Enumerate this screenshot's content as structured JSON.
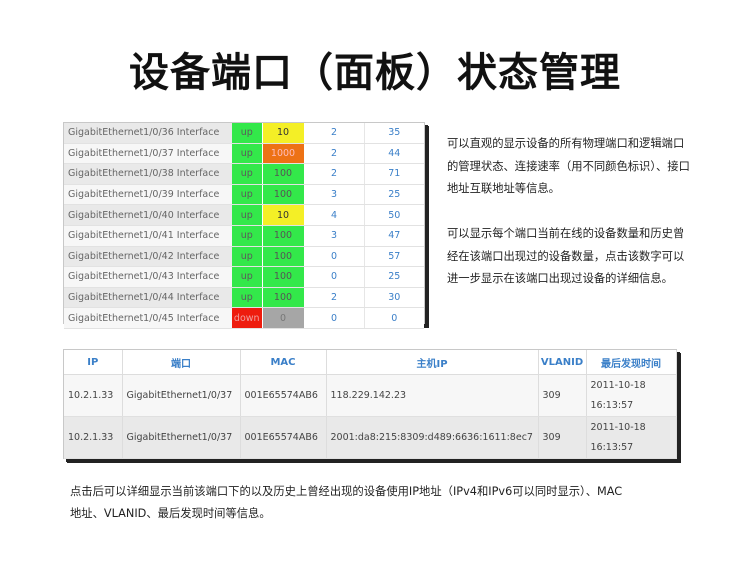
{
  "title": "设备端口（面板）状态管理",
  "ports": [
    {
      "iface": "GigabitEthernet1/0/36 Interface",
      "status": "up",
      "speed": "10",
      "speed_color": "yellow",
      "current": "2",
      "history": "35"
    },
    {
      "iface": "GigabitEthernet1/0/37 Interface",
      "status": "up",
      "speed": "1000",
      "speed_color": "orange",
      "current": "2",
      "history": "44"
    },
    {
      "iface": "GigabitEthernet1/0/38 Interface",
      "status": "up",
      "speed": "100",
      "speed_color": "green",
      "current": "2",
      "history": "71"
    },
    {
      "iface": "GigabitEthernet1/0/39 Interface",
      "status": "up",
      "speed": "100",
      "speed_color": "green",
      "current": "3",
      "history": "25"
    },
    {
      "iface": "GigabitEthernet1/0/40 Interface",
      "status": "up",
      "speed": "10",
      "speed_color": "yellow",
      "current": "4",
      "history": "50"
    },
    {
      "iface": "GigabitEthernet1/0/41 Interface",
      "status": "up",
      "speed": "100",
      "speed_color": "green",
      "current": "3",
      "history": "47"
    },
    {
      "iface": "GigabitEthernet1/0/42 Interface",
      "status": "up",
      "speed": "100",
      "speed_color": "green",
      "current": "0",
      "history": "57"
    },
    {
      "iface": "GigabitEthernet1/0/43 Interface",
      "status": "up",
      "speed": "100",
      "speed_color": "green",
      "current": "0",
      "history": "25"
    },
    {
      "iface": "GigabitEthernet1/0/44 Interface",
      "status": "up",
      "speed": "100",
      "speed_color": "green",
      "current": "2",
      "history": "30"
    },
    {
      "iface": "GigabitEthernet1/0/45 Interface",
      "status": "down",
      "speed": "0",
      "speed_color": "gray",
      "current": "0",
      "history": "0"
    }
  ],
  "desc1": [
    "可以直观的显示设备的所有物理端口和逻辑端口",
    "的管理状态、连接速率（用不同颜色标识）、接口",
    "地址互联地址等信息。"
  ],
  "desc2": [
    "可以显示每个端口当前在线的设备数量和历史曾",
    "经在该端口出现过的设备数量，点击该数字可以",
    "进一步显示在该端口出现过设备的详细信息。"
  ],
  "device_table": {
    "headers": [
      "IP",
      "端口",
      "MAC",
      "主机IP",
      "VLANID",
      "最后发现时间"
    ],
    "rows": [
      [
        "10.2.1.33",
        "GigabitEthernet1/0/37",
        "001E65574AB6",
        "118.229.142.23",
        "309",
        "2011-10-18 16:13:57"
      ],
      [
        "10.2.1.33",
        "GigabitEthernet1/0/37",
        "001E65574AB6",
        "2001:da8:215:8309:d489:6636:1611:8ec7",
        "309",
        "2011-10-18 16:13:57"
      ]
    ]
  },
  "footer": [
    "点击后可以详细显示当前该端口下的以及历史上曾经出现的设备使用IP地址（IPv4和IPv6可以同时显示）、MAC",
    "地址、VLANID、最后发现时间等信息。"
  ],
  "colors": {
    "up": "#33e84a",
    "down": "#ee1c0e",
    "speed_10": "#f4ef26",
    "speed_1000": "#ed7215",
    "speed_100": "#33e84a",
    "speed_0": "#a6a6a6",
    "link_blue": "#3a7fc8"
  }
}
